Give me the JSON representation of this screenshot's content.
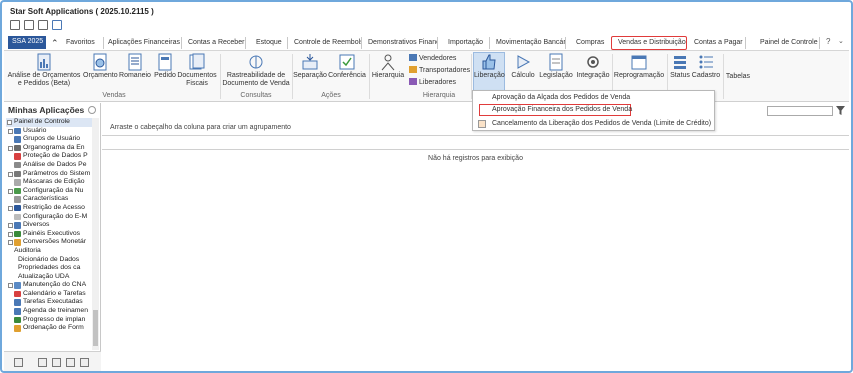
{
  "window": {
    "title": "Star Soft Applications ( 2025.10.2115 )"
  },
  "app_tab": "SSA 2025",
  "tabs": [
    {
      "label": "Favoritos"
    },
    {
      "label": "Aplicações Financeiras"
    },
    {
      "label": "Contas a Receber"
    },
    {
      "label": "Estoque"
    },
    {
      "label": "Controle de Reembolso"
    },
    {
      "label": "Demonstrativos Financ"
    },
    {
      "label": "Importação"
    },
    {
      "label": "Movimentação Bancár"
    },
    {
      "label": "Compras"
    },
    {
      "label": "Vendas e Distribuição"
    },
    {
      "label": "Contas a Pagar"
    },
    {
      "label": "Painel de Controle"
    }
  ],
  "help_label": "?",
  "ribbon": {
    "buttons": [
      {
        "label": "Análise de Orçamentos\ne Pedidos (Beta)"
      },
      {
        "label": "Orçamento"
      },
      {
        "label": "Romaneio"
      },
      {
        "label": "Pedido"
      },
      {
        "label": "Documentos\nFiscais"
      },
      {
        "label": "Rastreabilidade de\nDocumento de Venda"
      },
      {
        "label": "Separação"
      },
      {
        "label": "Conferência"
      },
      {
        "label": "Hierarquia"
      },
      {
        "label": "Liberação"
      },
      {
        "label": "Cálculo"
      },
      {
        "label": "Legislação"
      },
      {
        "label": "Integração"
      },
      {
        "label": "Reprogramação"
      },
      {
        "label": "Status"
      },
      {
        "label": "Cadastro"
      },
      {
        "label": "Tabelas"
      }
    ],
    "small_buttons": [
      "Vendedores",
      "Transportadores",
      "Liberadores"
    ],
    "groups": [
      "Vendas",
      "Consultas",
      "Ações",
      "Hierarquia"
    ]
  },
  "sidebar": {
    "title": "Minhas Aplicações",
    "items": [
      {
        "label": "Painel de Controle"
      },
      {
        "label": "Usuário"
      },
      {
        "label": "Grupos de Usuário"
      },
      {
        "label": "Organograma da En"
      },
      {
        "label": "Proteção de Dados P"
      },
      {
        "label": "Análise de Dados Pe"
      },
      {
        "label": "Parâmetros do Sistem"
      },
      {
        "label": "Máscaras de Edição"
      },
      {
        "label": "Configuração da Nu"
      },
      {
        "label": "Características"
      },
      {
        "label": "Restrição de Acesso"
      },
      {
        "label": "Configuração do E-M"
      },
      {
        "label": "Diversos"
      },
      {
        "label": "Painéis Executivos"
      },
      {
        "label": "Conversões Monetár"
      },
      {
        "label": "Auditoria"
      },
      {
        "label": "Dicionário de Dados"
      },
      {
        "label": "Propriedades dos ca"
      },
      {
        "label": "Atualização UDA"
      },
      {
        "label": "Manutenção do CNA"
      },
      {
        "label": "Calendário e Tarefas"
      },
      {
        "label": "Tarefas Executadas"
      },
      {
        "label": "Agenda de treinamen"
      },
      {
        "label": "Progresso de implan"
      },
      {
        "label": "Ordenação de Form"
      }
    ]
  },
  "main": {
    "group_hint": "Arraste o cabeçalho da coluna para criar um agrupamento",
    "empty_text": "Não há registros para exibição"
  },
  "dropdown": {
    "items": [
      {
        "label": "Aprovação da Alçada dos Pedidos de Venda"
      },
      {
        "label": "Aprovação Financeira dos Pedidos de Venda"
      },
      {
        "label": "Cancelamento da Liberação dos Pedidos de Venda (Limite de Crédito)"
      }
    ]
  },
  "colors": {
    "accent": "#2b579a",
    "highlight": "#e03b3b",
    "frame": "#6fa8dc"
  }
}
